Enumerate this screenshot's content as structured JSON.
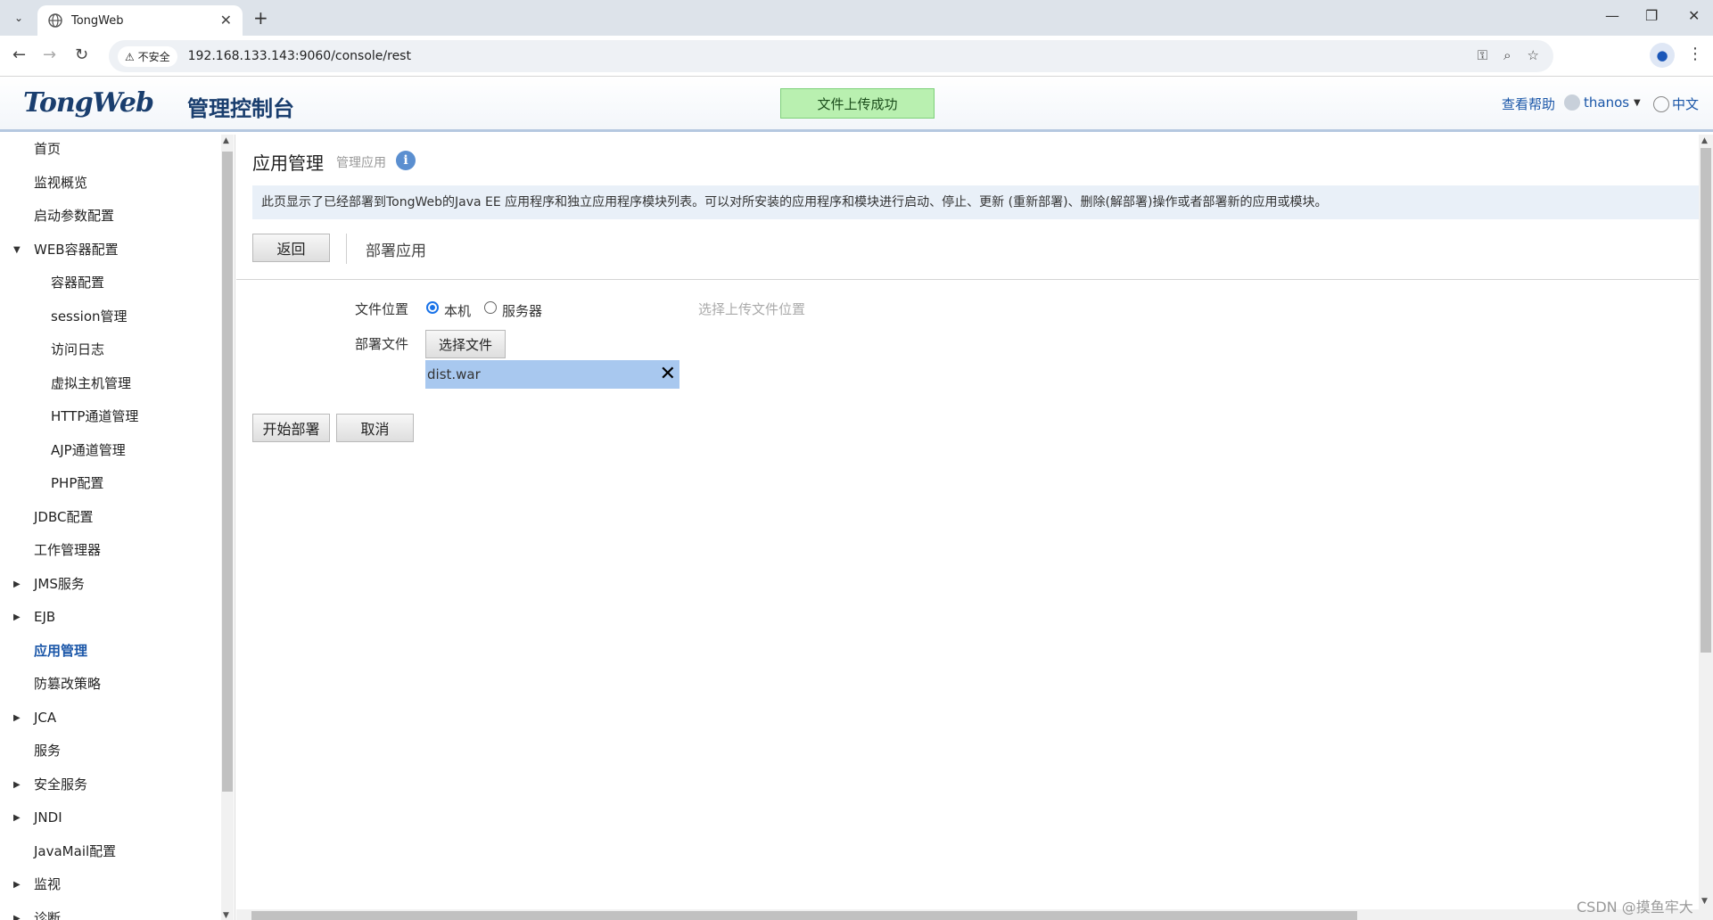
{
  "browser": {
    "tab_title": "TongWeb",
    "security_label": "不安全",
    "url": "192.168.133.143:9060/console/rest"
  },
  "header": {
    "logo_text": "TongWeb",
    "logo_subtitle": "管理控制台",
    "toast": "文件上传成功",
    "help": "查看帮助",
    "username": "thanos",
    "language": "中文"
  },
  "sidebar": {
    "items": [
      {
        "label": "首页",
        "expander": ""
      },
      {
        "label": "监视概览",
        "expander": ""
      },
      {
        "label": "启动参数配置",
        "expander": ""
      },
      {
        "label": "WEB容器配置",
        "expander": "▼"
      },
      {
        "label": "容器配置",
        "expander": ""
      },
      {
        "label": "session管理",
        "expander": ""
      },
      {
        "label": "访问日志",
        "expander": ""
      },
      {
        "label": "虚拟主机管理",
        "expander": ""
      },
      {
        "label": "HTTP通道管理",
        "expander": ""
      },
      {
        "label": "AJP通道管理",
        "expander": ""
      },
      {
        "label": "PHP配置",
        "expander": ""
      },
      {
        "label": "JDBC配置",
        "expander": ""
      },
      {
        "label": "工作管理器",
        "expander": ""
      },
      {
        "label": "JMS服务",
        "expander": "▶"
      },
      {
        "label": "EJB",
        "expander": "▶"
      },
      {
        "label": "应用管理",
        "expander": ""
      },
      {
        "label": "防篡改策略",
        "expander": ""
      },
      {
        "label": "JCA",
        "expander": "▶"
      },
      {
        "label": "服务",
        "expander": ""
      },
      {
        "label": "安全服务",
        "expander": "▶"
      },
      {
        "label": "JNDI",
        "expander": "▶"
      },
      {
        "label": "JavaMail配置",
        "expander": ""
      },
      {
        "label": "监视",
        "expander": "▶"
      },
      {
        "label": "诊断",
        "expander": "▶"
      }
    ]
  },
  "main": {
    "title": "应用管理",
    "subtitle": "管理应用",
    "description": "此页显示了已经部署到TongWeb的Java EE 应用程序和独立应用程序模块列表。可以对所安装的应用程序和模块进行启动、停止、更新 (重新部署)、删除(解部署)操作或者部署新的应用或模块。",
    "back_button": "返回",
    "section_title": "部署应用",
    "file_location_label": "文件位置",
    "option_local": "本机",
    "option_server": "服务器",
    "upload_hint": "选择上传文件位置",
    "deploy_file_label": "部署文件",
    "choose_file_button": "选择文件",
    "selected_file": "dist.war",
    "start_deploy_button": "开始部署",
    "cancel_button": "取消"
  },
  "watermark": "CSDN @摸鱼牢大"
}
